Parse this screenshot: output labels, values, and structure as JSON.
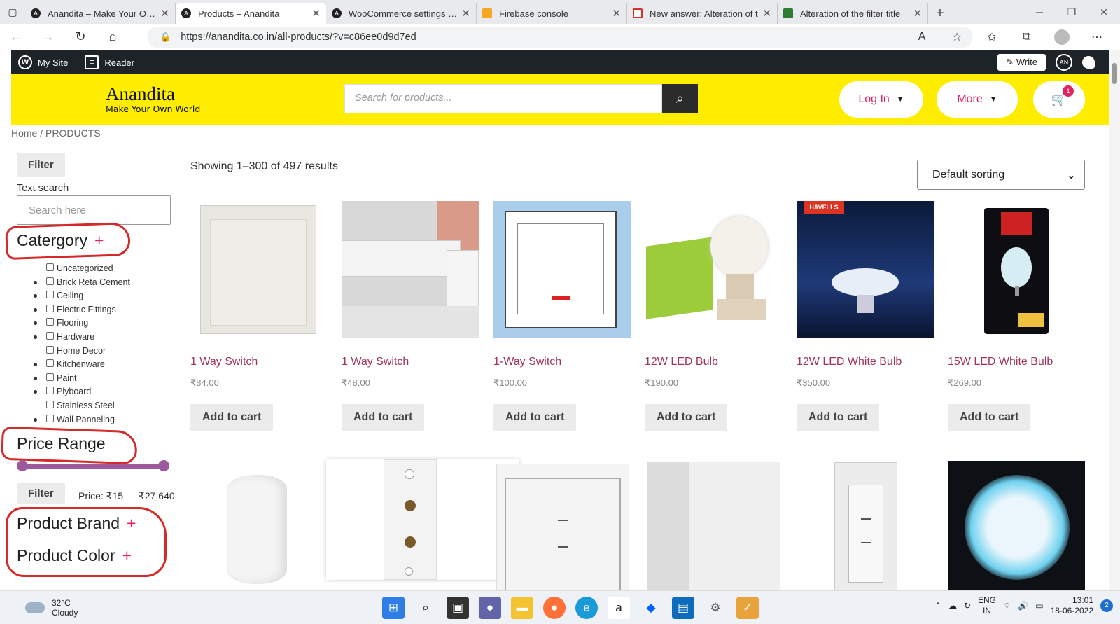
{
  "browser": {
    "tabs": [
      {
        "title": "Anandita – Make Your Own",
        "active": false
      },
      {
        "title": "Products – Anandita",
        "active": true
      },
      {
        "title": "WooCommerce settings ‹ A",
        "active": false
      },
      {
        "title": "Firebase console",
        "active": false
      },
      {
        "title": "New answer: Alteration of t",
        "active": false
      },
      {
        "title": "Alteration of the filter title",
        "active": false
      }
    ],
    "url": "https://anandita.co.in/all-products/?v=c86ee0d9d7ed"
  },
  "wpbar": {
    "my_site": "My Site",
    "reader": "Reader",
    "write": "Write"
  },
  "site": {
    "logo_title": "Anandita",
    "logo_tagline": "Make Your Own World",
    "search_placeholder": "Search for products...",
    "login_label": "Log In",
    "more_label": "More",
    "cart_count": "1"
  },
  "breadcrumb": "Home / PRODUCTS",
  "sidebar": {
    "filter_button": "Filter",
    "text_search_label": "Text search",
    "search_placeholder": "Search here",
    "category_heading": "Catergory",
    "categories": [
      {
        "label": "Uncategorized",
        "bullet": false
      },
      {
        "label": "Brick Reta Cement",
        "bullet": true
      },
      {
        "label": "Ceiling",
        "bullet": true
      },
      {
        "label": "Electric Fittings",
        "bullet": true
      },
      {
        "label": "Flooring",
        "bullet": true
      },
      {
        "label": "Hardware",
        "bullet": true
      },
      {
        "label": "Home Decor",
        "bullet": false
      },
      {
        "label": "Kitchenware",
        "bullet": true
      },
      {
        "label": "Paint",
        "bullet": true
      },
      {
        "label": "Plyboard",
        "bullet": true
      },
      {
        "label": "Stainless Steel",
        "bullet": false
      },
      {
        "label": "Wall Panneling",
        "bullet": true
      }
    ],
    "price_heading": "Price Range",
    "price_filter_button": "Filter",
    "price_text": "Price: ₹15 — ₹27,640",
    "brand_heading": "Product Brand",
    "color_heading": "Product Color",
    "plus": "+"
  },
  "main": {
    "result_count": "Showing 1–300 of 497 results",
    "sort_label": "Default sorting",
    "add_to_cart": "Add to cart",
    "products": [
      {
        "name": "1 Way Switch",
        "price": "₹84.00"
      },
      {
        "name": "1 Way Switch",
        "price": "₹48.00"
      },
      {
        "name": "1-Way Switch",
        "price": "₹100.00"
      },
      {
        "name": "12W LED Bulb",
        "price": "₹190.00"
      },
      {
        "name": "12W LED White Bulb",
        "price": "₹350.00"
      },
      {
        "name": "15W LED White Bulb",
        "price": "₹269.00"
      }
    ]
  },
  "taskbar": {
    "temp": "32°C",
    "weather": "Cloudy",
    "lang1": "ENG",
    "lang2": "IN",
    "time": "13:01",
    "date": "18-06-2022",
    "notifications": "2"
  },
  "colors": {
    "header_yellow": "#ffed00",
    "accent_pink": "#e0245e",
    "product_link": "#a3325d",
    "annotation_red": "#d32a2a"
  }
}
